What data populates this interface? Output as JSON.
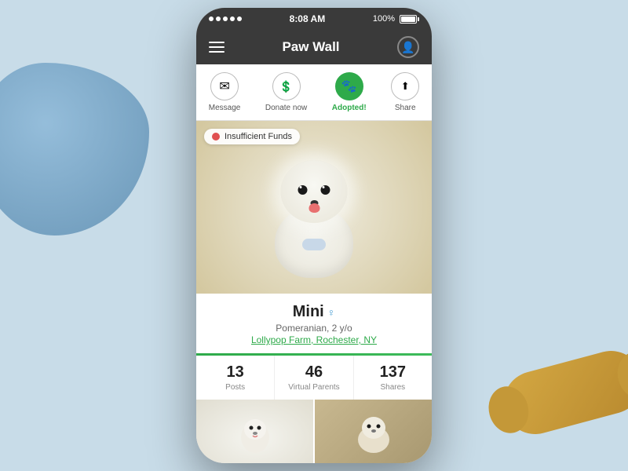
{
  "background": {
    "color": "#c8dce8"
  },
  "statusBar": {
    "dots": 5,
    "wifi": "wifi",
    "time": "8:08 AM",
    "battery": "100%"
  },
  "navBar": {
    "title": "Paw Wall",
    "notificationCount": "0"
  },
  "actions": [
    {
      "id": "message",
      "icon": "✉",
      "label": "Message",
      "active": false
    },
    {
      "id": "donate",
      "icon": "💲",
      "label": "Donate now",
      "active": false
    },
    {
      "id": "adopted",
      "icon": "🐾",
      "label": "Adopted!",
      "active": true
    },
    {
      "id": "share",
      "icon": "⬆",
      "label": "Share",
      "active": false
    }
  ],
  "insufficientFunds": {
    "label": "Insufficient Funds"
  },
  "pet": {
    "name": "Mini",
    "gender": "♀",
    "breed": "Pomeranian, 2 y/o",
    "location": "Lollypop Farm, Rochester, NY"
  },
  "stats": [
    {
      "value": "13",
      "label": "Posts"
    },
    {
      "value": "46",
      "label": "Virtual Parents"
    },
    {
      "value": "137",
      "label": "Shares"
    }
  ]
}
